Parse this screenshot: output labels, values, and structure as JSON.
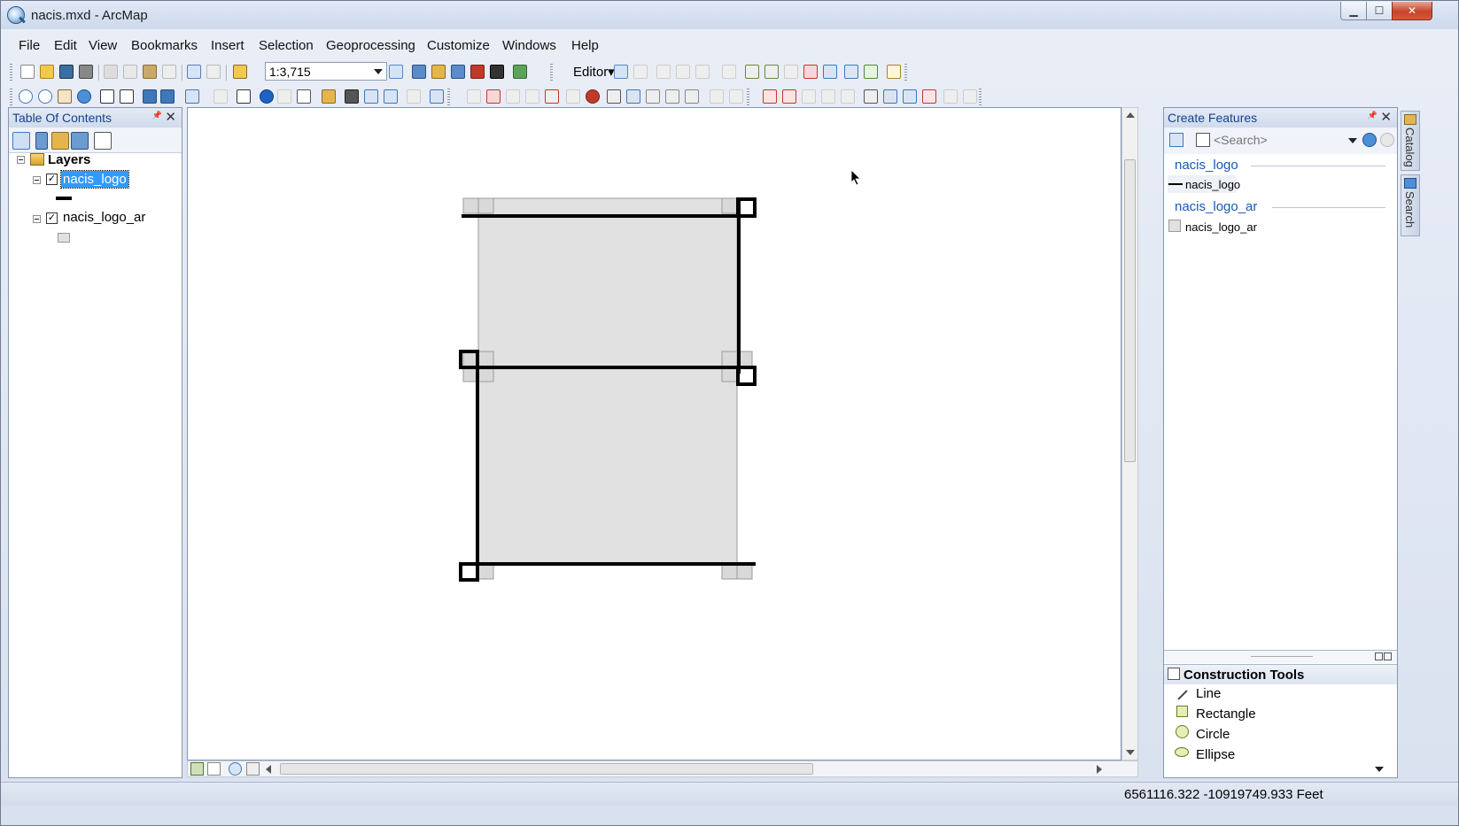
{
  "window": {
    "title": "nacis.mxd - ArcMap",
    "min_glyph": "▁",
    "max_glyph": "☐",
    "close_glyph": "✕"
  },
  "menubar": {
    "items": [
      "File",
      "Edit",
      "View",
      "Bookmarks",
      "Insert",
      "Selection",
      "Geoprocessing",
      "Customize",
      "Windows",
      "Help"
    ]
  },
  "toolbar": {
    "scale": "1:3,715",
    "editor_label": "Editor▾"
  },
  "toc": {
    "title": "Table Of Contents",
    "pin_glyph": "📌",
    "close_glyph": "✕",
    "root_label": "Layers",
    "layers": [
      {
        "name": "nacis_logo",
        "checked": true,
        "selected": true,
        "symbol": "line"
      },
      {
        "name": "nacis_logo_ar",
        "checked": true,
        "selected": false,
        "symbol": "polygon"
      }
    ],
    "check_glyph": "✓"
  },
  "create_features": {
    "title": "Create Features",
    "pin_glyph": "📌",
    "close_glyph": "✕",
    "search_placeholder": "<Search>",
    "groups": [
      {
        "group": "nacis_logo",
        "item": "nacis_logo",
        "symbol": "line"
      },
      {
        "group": "nacis_logo_ar",
        "item": "nacis_logo_ar",
        "symbol": "polygon"
      }
    ],
    "construction_title": "Construction Tools",
    "construction_tools": [
      "Line",
      "Rectangle",
      "Circle",
      "Ellipse"
    ]
  },
  "side_tabs": [
    "Catalog",
    "Search"
  ],
  "status": {
    "coordinates": "6561116.322  -10919749.933 Feet"
  },
  "colors": {
    "selection": "#3399ff",
    "polygon_fill": "#e1e1e1",
    "link_blue": "#1a58b3"
  }
}
